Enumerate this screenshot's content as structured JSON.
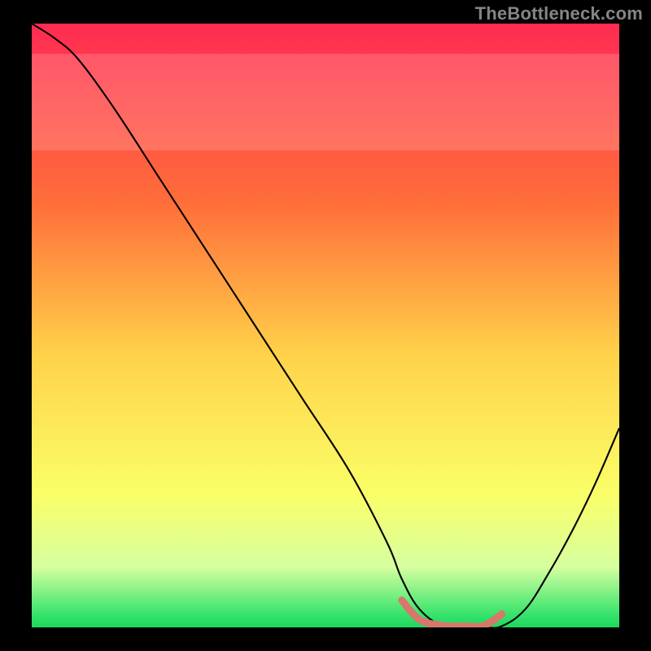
{
  "watermark": "TheBottleneck.com",
  "chart_data": {
    "type": "line",
    "title": "",
    "xlabel": "",
    "ylabel": "",
    "xlim": [
      0,
      100
    ],
    "ylim": [
      0,
      100
    ],
    "gradient_stops": [
      {
        "offset": 0,
        "color": "#ff2b52"
      },
      {
        "offset": 0.3,
        "color": "#ff6f3a"
      },
      {
        "offset": 0.55,
        "color": "#ffd24a"
      },
      {
        "offset": 0.78,
        "color": "#faff68"
      },
      {
        "offset": 0.9,
        "color": "#d6ffa0"
      },
      {
        "offset": 0.98,
        "color": "#34e36b"
      },
      {
        "offset": 1.0,
        "color": "#1fd65e"
      }
    ],
    "pale_band": {
      "y0": 79,
      "y1": 95,
      "opacity": 0.16
    },
    "series": [
      {
        "name": "curve",
        "stroke": "#000000",
        "stroke_width": 2.1,
        "x": [
          0,
          4,
          8,
          14,
          22,
          30,
          38,
          46,
          54,
          60.5,
          63,
          66,
          70,
          74,
          77,
          80,
          84,
          88,
          92,
          96,
          100
        ],
        "y": [
          100,
          97.5,
          94,
          86,
          74,
          62,
          50,
          38,
          26,
          14,
          8,
          3,
          0.2,
          0,
          0,
          0.2,
          3,
          9,
          16,
          24,
          33
        ]
      },
      {
        "name": "valley-accent",
        "stroke": "#d8776c",
        "stroke_width": 9,
        "linecap": "round",
        "x": [
          63,
          66,
          70,
          74,
          77,
          80
        ],
        "y": [
          4.5,
          1.3,
          0.3,
          0.2,
          0.3,
          2.2
        ]
      }
    ]
  }
}
